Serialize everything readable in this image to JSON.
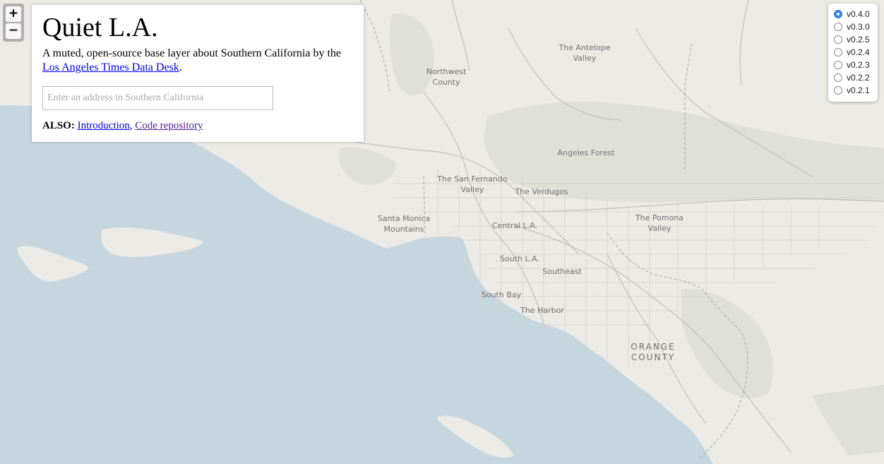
{
  "map": {
    "labels": [
      {
        "text": "The Antelope\nValley",
        "kind": "region"
      },
      {
        "text": "Northwest\nCounty",
        "kind": "region"
      },
      {
        "text": "Angeles Forest",
        "kind": "region"
      },
      {
        "text": "The San Fernando\nValley",
        "kind": "region"
      },
      {
        "text": "The Verdugos",
        "kind": "region"
      },
      {
        "text": "Santa Monica\nMountains",
        "kind": "region"
      },
      {
        "text": "Central L.A.",
        "kind": "region"
      },
      {
        "text": "The Pomona\nValley",
        "kind": "region"
      },
      {
        "text": "South L.A.",
        "kind": "region"
      },
      {
        "text": "Southeast",
        "kind": "region"
      },
      {
        "text": "South Bay",
        "kind": "region"
      },
      {
        "text": "The Harbor",
        "kind": "region"
      },
      {
        "text": "ORANGE\nCOUNTY",
        "kind": "county"
      }
    ],
    "colors": {
      "water": "#c5d6de",
      "land": "#eceae5",
      "park": "#dfe1d9",
      "road": "#bcbcbc"
    }
  },
  "zoom": {
    "in_label": "+",
    "out_label": "−"
  },
  "panel": {
    "title": "Quiet L.A.",
    "desc_prefix": "A muted, open-source base layer about Southern California by the ",
    "desc_link": "Los Angeles Times Data Desk",
    "desc_suffix": ".",
    "search_placeholder": "Enter an address in Southern California",
    "search_value": "",
    "also_label": "ALSO:",
    "link_intro": "Introduction",
    "link_sep": ",",
    "link_repo": "Code repository"
  },
  "versions": {
    "selected": "v0.4.0",
    "items": [
      "v0.4.0",
      "v0.3.0",
      "v0.2.5",
      "v0.2.4",
      "v0.2.3",
      "v0.2.2",
      "v0.2.1"
    ]
  }
}
